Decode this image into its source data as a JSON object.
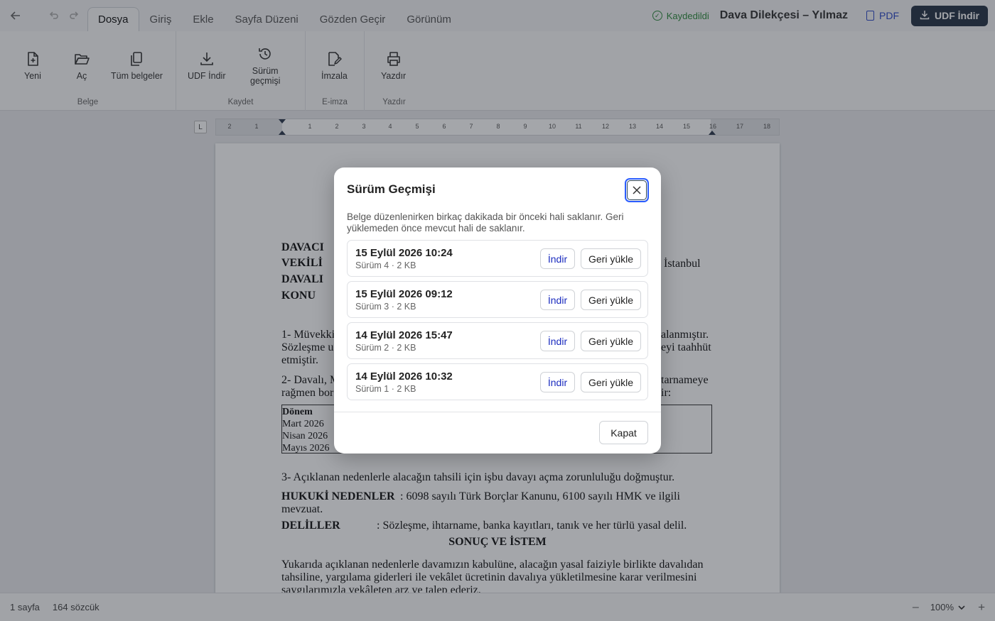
{
  "topbar": {
    "tabs": [
      "Dosya",
      "Giriş",
      "Ekle",
      "Sayfa Düzeni",
      "Gözden Geçir",
      "Görünüm"
    ],
    "saved_label": "Kaydedildi",
    "doc_title": "Dava Dilekçesi – Yılmaz",
    "pdf_label": "PDF",
    "udf_label": "UDF İndir"
  },
  "ribbon": {
    "belge": {
      "label": "Belge",
      "new": "Yeni",
      "open": "Aç",
      "all": "Tüm belgeler"
    },
    "kaydet": {
      "label": "Kaydet",
      "udf": "UDF İndir",
      "history_line1": "Sürüm",
      "history_line2": "geçmişi"
    },
    "eimza": {
      "label": "E-imza",
      "sign": "İmzala"
    },
    "yazdir": {
      "label": "Yazdır",
      "print": "Yazdır"
    }
  },
  "ruler": {
    "corner": "L",
    "ticks": [
      "2",
      "1",
      "1",
      "2",
      "3",
      "4",
      "5",
      "6",
      "7",
      "8",
      "9",
      "10",
      "11",
      "12",
      "13",
      "14",
      "15",
      "16",
      "17",
      "18"
    ]
  },
  "document": {
    "davaci": "DAVACI",
    "vekili": "VEKİLİ",
    "davali": "DAVALI",
    "konu": "KONU",
    "istanbul": "İstanbul",
    "p1_line1_a": "1- Müvekki",
    "p1_line1_b": "alanmıştır.",
    "p1_line2_a": "Sözleşme u",
    "p1_line2_b": "eyi taahhüt",
    "p1_line3": "etmiştir.",
    "p2_line1_a": "2- Davalı, M",
    "p2_line1_b": "tarnameye",
    "p2_line2_a": "rağmen bor",
    "p2_line2_b": "ir:",
    "table_header": "Dönem",
    "table_rows": [
      "Mart 2026",
      "Nisan 2026",
      "Mayıs 2026"
    ],
    "p3": "3- Açıklanan nedenlerle alacağın tahsili için işbu davayı açma zorunluluğu doğmuştur.",
    "hukuki_label": "HUKUKİ NEDENLER",
    "hukuki_text": ": 6098 sayılı Türk Borçlar Kanunu, 6100 sayılı HMK ve ilgili",
    "hukuki_text2": "mevzuat.",
    "deliller_label": "DELİLLER",
    "deliller_text": ": Sözleşme, ihtarname, banka kayıtları, tanık ve her türlü yasal delil.",
    "sonuc": "SONUÇ VE İSTEM",
    "final_line1": "Yukarıda açıklanan nedenlerle davamızın kabulüne, alacağın yasal faiziyle birlikte davalıdan",
    "final_line2": "tahsiline, yargılama giderleri ile vekâlet ücretinin davalıya yükletilmesine karar verilmesini",
    "final_line3": "saygılarımızla vekâleten arz ve talep ederiz."
  },
  "statusbar": {
    "pages": "1 sayfa",
    "words": "164 sözcük",
    "zoom": "100%"
  },
  "modal": {
    "title": "Sürüm Geçmişi",
    "description": "Belge düzenlenirken birkaç dakikada bir önceki hali saklanır. Geri yüklemeden önce mevcut hali de saklanır.",
    "download_label": "İndir",
    "restore_label": "Geri yükle",
    "close_label": "Kapat",
    "versions": [
      {
        "date": "15 Eylül 2026 10:24",
        "meta": "Sürüm 4 · 2 KB"
      },
      {
        "date": "15 Eylül 2026 09:12",
        "meta": "Sürüm 3 · 2 KB"
      },
      {
        "date": "14 Eylül 2026 15:47",
        "meta": "Sürüm 2 · 2 KB"
      },
      {
        "date": "14 Eylül 2026 10:32",
        "meta": "Sürüm 1 · 2 KB"
      }
    ]
  }
}
